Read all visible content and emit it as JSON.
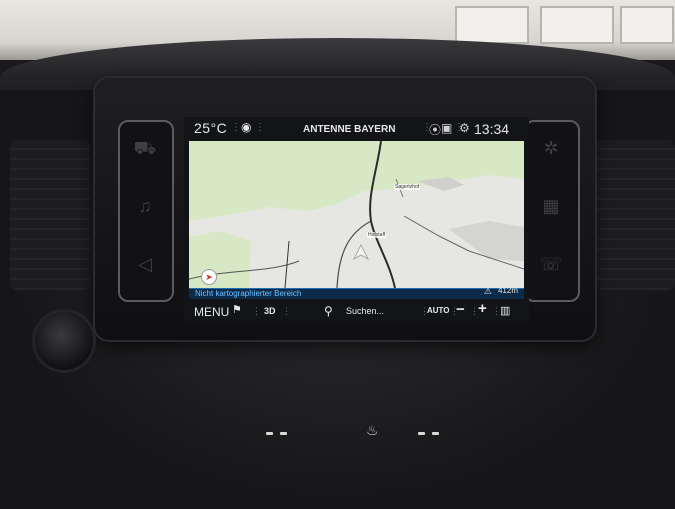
{
  "status": {
    "temperature": "25°C",
    "station": "ANTENNE BAYERN",
    "time": "13:34",
    "icons": [
      "radio-icon",
      "navigation-pin-icon",
      "telephone-icon",
      "settings-icon"
    ]
  },
  "map": {
    "places": [
      "Sagertzhof",
      "Hofstaff"
    ],
    "north_icon": "compass-icon"
  },
  "info": {
    "unmapped_text": "Nicht kartographierter Bereich",
    "distance": "412m"
  },
  "toolbar": {
    "menu": "MENU",
    "view_3d": "3D",
    "search": "Suchen...",
    "auto": "AUTO",
    "zoom_out": "−",
    "zoom_in": "+"
  },
  "colors": {
    "map_bg": "#e6e6e3",
    "forest": "#d7e8c5",
    "highlight_blue": "#6ec2ff",
    "screen_bg": "#121418"
  }
}
